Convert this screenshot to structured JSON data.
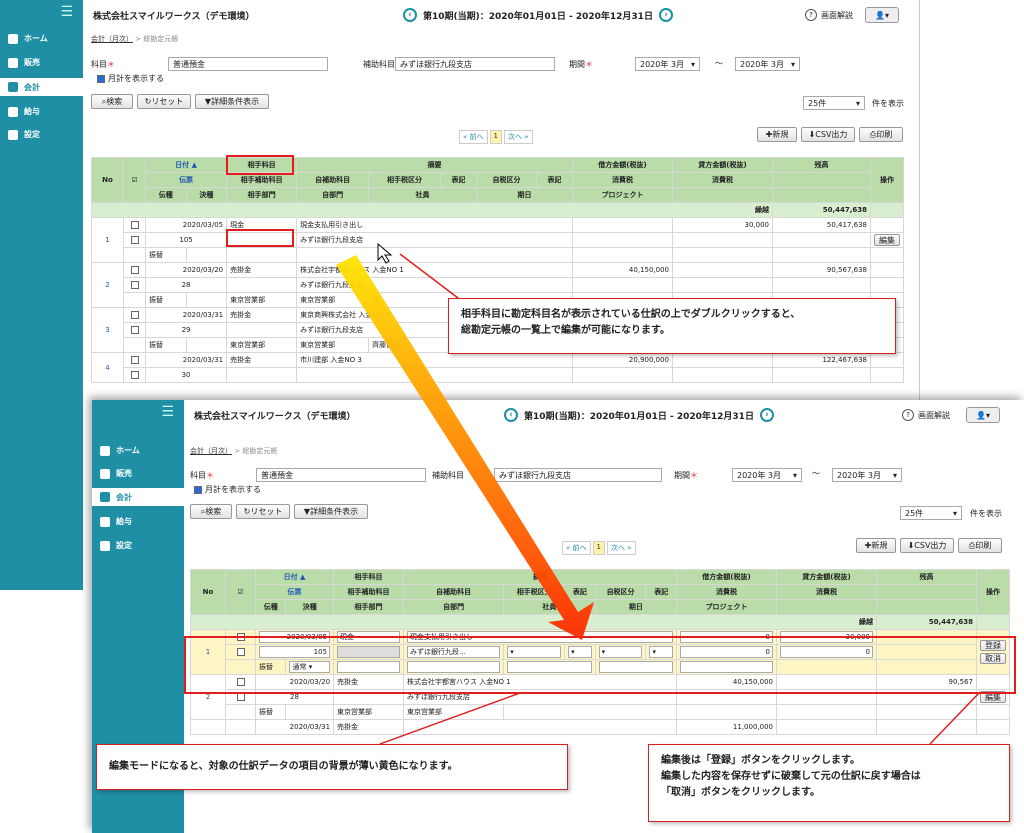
{
  "sidebar": {
    "items": [
      {
        "label": "ホーム",
        "icon": "home-icon"
      },
      {
        "label": "販売",
        "icon": "cart-icon"
      },
      {
        "label": "会計",
        "icon": "calculator-icon"
      },
      {
        "label": "給与",
        "icon": "money-bag-icon"
      },
      {
        "label": "設定",
        "icon": "gear-icon"
      }
    ],
    "active": "会計"
  },
  "header": {
    "company": "株式会社スマイルワークス（デモ環境）",
    "period": "第10期(当期)：2020年01月01日 - 2020年12月31日",
    "help": "画面解説"
  },
  "breadcrumb": {
    "parent": "会計（月次）",
    "sep": ">",
    "current": "総勘定元帳"
  },
  "filter": {
    "account_label": "科目",
    "account_value": "普通預金",
    "sub_label": "補助科目",
    "sub_value": "みずほ銀行九段支店",
    "period_label": "期間",
    "from": "2020年 3月",
    "tilde": "～",
    "to": "2020年 3月",
    "monthly": "月計を表示する"
  },
  "toolbar": {
    "search": "検索",
    "reset": "リセット",
    "detail": "詳細条件表示",
    "perpage": "25件",
    "perpage_suffix": "件を表示",
    "new": "新規",
    "csv": "CSV出力",
    "print": "印刷"
  },
  "pager": {
    "prev": "« 前へ",
    "page": "1",
    "next": "次へ »"
  },
  "table": {
    "headers": {
      "no": "No",
      "chk": "☑",
      "date": "日付 ▲",
      "counter": "相手科目",
      "summary": "摘要",
      "credit_amt": "借方金額(税抜)",
      "debit_amt": "貸方金額(税抜)",
      "balance": "残高",
      "action": "操作",
      "denpyo": "伝票",
      "counter_sub": "相手補助科目",
      "sub_acc": "自補助科目",
      "counter_tax": "相手税区分",
      "hyoki": "表記",
      "self_tax": "自税区分",
      "hyoki2": "表記",
      "tax1": "消費税",
      "tax2": "消費税",
      "denno": "伝種",
      "kessan": "決種",
      "counter_dept": "相手部門",
      "self_dept": "自部門",
      "staff": "社員",
      "period": "期日",
      "project": "プロジェクト"
    },
    "carry_label": "繰越",
    "carry_value": "50,447,638",
    "rows": [
      {
        "no": "1",
        "date": "2020/03/05",
        "counter": "現金",
        "summary": "現金支払用引き出し",
        "credit": "",
        "debit": "30,000",
        "balance": "50,417,638",
        "denpyo": "105",
        "sub": "みずほ銀行九段支店",
        "kind": "振替",
        "dept": "",
        "selfdept": "",
        "extra": ""
      },
      {
        "no": "2",
        "date": "2020/03/20",
        "counter": "売掛金",
        "summary": "株式会社宇都宮ハウス 入金NO 1",
        "credit": "40,150,000",
        "debit": "",
        "balance": "90,567,638",
        "denpyo": "28",
        "sub": "みずほ銀行九段支店",
        "kind": "振替",
        "dept": "東京営業部",
        "selfdept": "東京営業部",
        "extra": "様"
      },
      {
        "no": "3",
        "date": "2020/03/31",
        "counter": "売掛金",
        "summary": "東京商興株式会社 入金NO 2",
        "credit": "",
        "debit": "",
        "balance": "",
        "denpyo": "29",
        "sub": "みずほ銀行九段支店",
        "kind": "振替",
        "dept": "東京営業部",
        "selfdept": "東京営業部",
        "extra": "齊藤健太"
      },
      {
        "no": "4",
        "date": "2020/03/31",
        "counter": "売掛金",
        "summary": "市川建部 入金NO 3",
        "credit": "20,900,000",
        "debit": "",
        "balance": "122,467,638",
        "denpyo": "30",
        "sub": "",
        "kind": "",
        "dept": "",
        "selfdept": "",
        "extra": ""
      }
    ],
    "edit_btn": "編集",
    "edit_row": {
      "date": "2020/03/05",
      "counter": "現金",
      "summary": "現金支払用引き出し",
      "credit": "0",
      "debit": "30,000",
      "denpyo": "105",
      "sub": "みずほ銀行九段…",
      "zero1": "0",
      "zero2": "0",
      "kind": "振替",
      "kind_sel": "通常",
      "register": "登録",
      "cancel": "取消"
    },
    "row2b": {
      "date": "2020/03/20",
      "counter": "売掛金",
      "summary": "株式会社宇都宮ハウス 入金NO 1",
      "credit": "40,150,000",
      "balance": "90,567",
      "denpyo": "28",
      "sub": "みずほ銀行九段支店",
      "kind": "振替",
      "dept": "東京営業部",
      "selfdept": "東京営業部",
      "date3": "2020/03/31",
      "counter3": "売掛金",
      "credit3": "11,000,000"
    }
  },
  "callouts": {
    "top": "相手科目に勘定科目名が表示されている仕訳の上でダブルクリックすると、\n総勘定元帳の一覧上で編集が可能になります。",
    "bottom_left": "編集モードになると、対象の仕訳データの項目の背景が薄い黄色になります。",
    "bottom_right": "編集後は「登録」ボタンをクリックします。\n編集した内容を保存せずに破棄して元の仕訳に戻す場合は\n「取消」ボタンをクリックします。"
  }
}
